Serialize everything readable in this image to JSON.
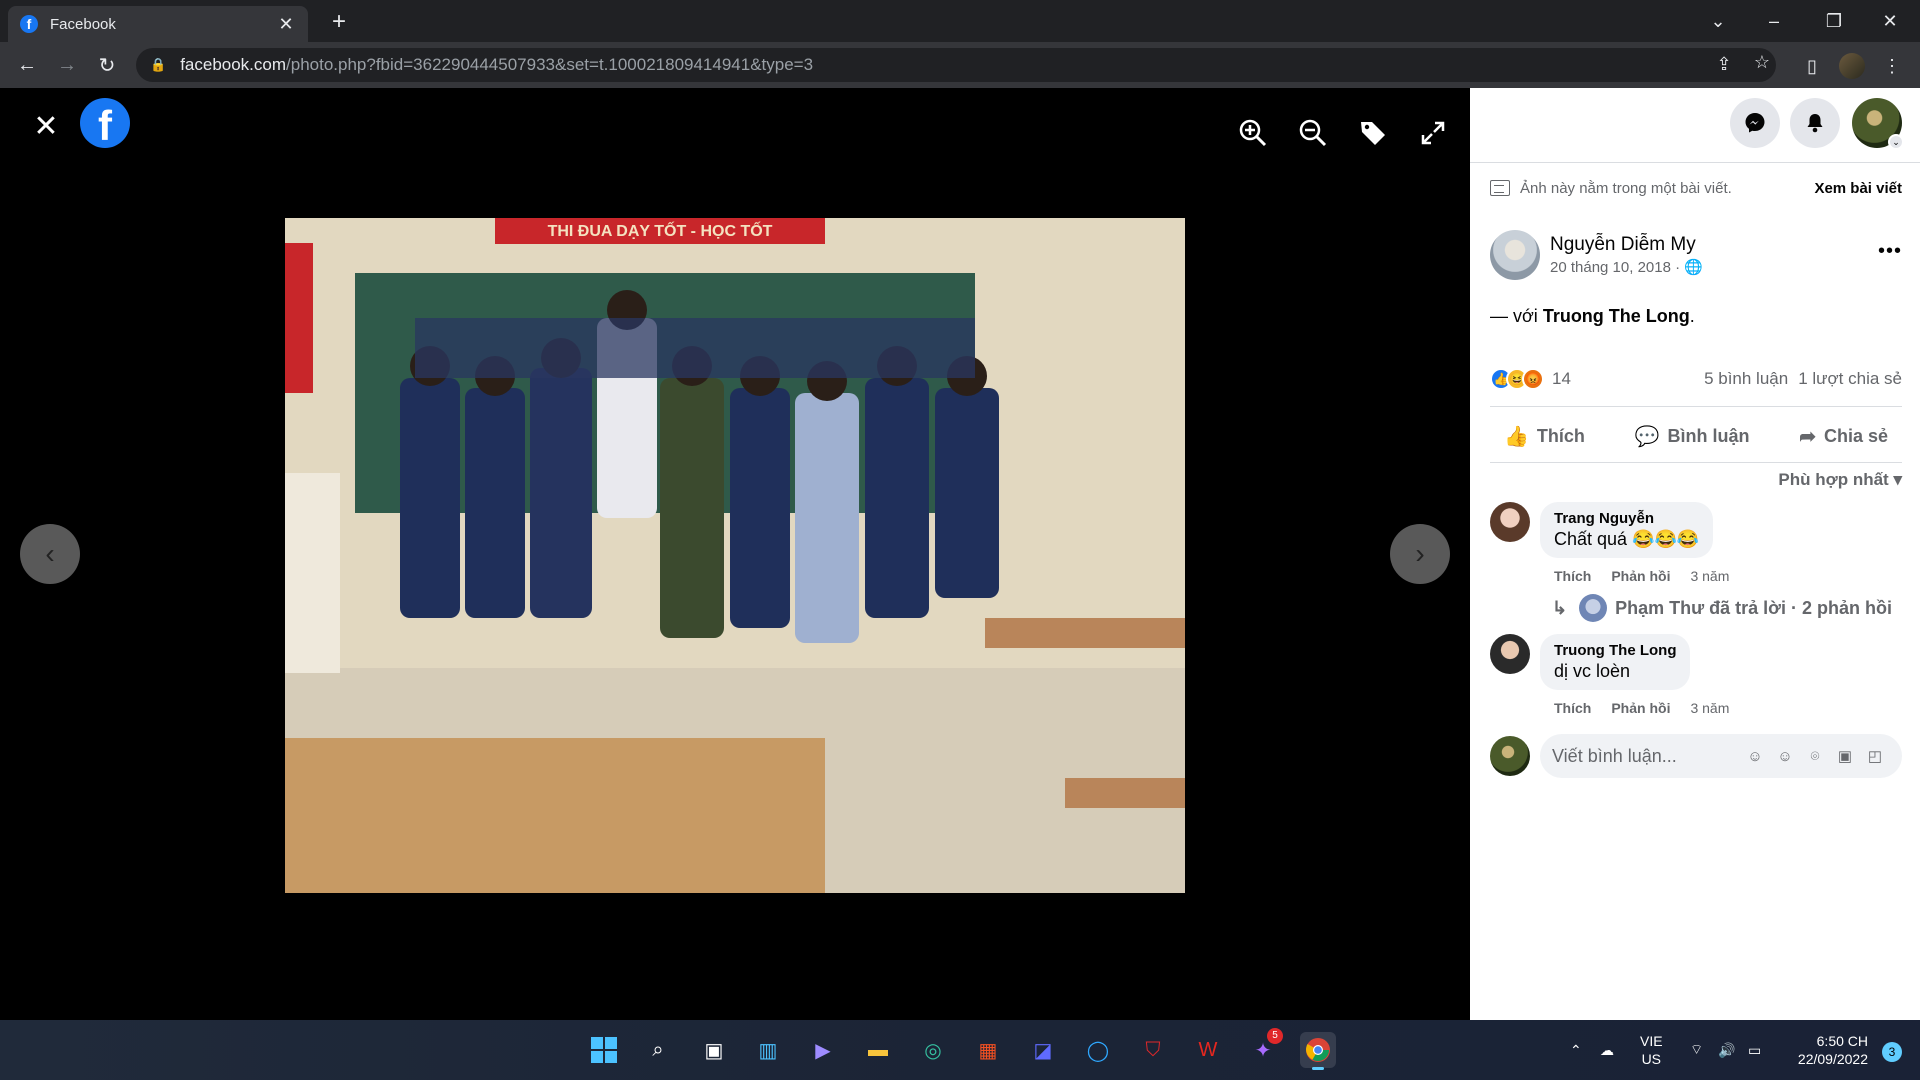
{
  "browser": {
    "tab_title": "Facebook",
    "tab_favicon": "f",
    "url_host": "facebook.com",
    "url_path": "/photo.php?fbid=362290444507933&set=t.100021809414941&type=3",
    "accent": "#1877f2"
  },
  "viewer": {
    "logo_letter": "f",
    "tools": [
      "zoom-in-icon",
      "zoom-out-icon",
      "tag-icon",
      "fullscreen-icon"
    ]
  },
  "panel": {
    "notice_text": "Ảnh này nằm trong một bài viết.",
    "notice_link": "Xem bài viết",
    "post": {
      "author": "Nguyễn Diễm My",
      "date": "20 tháng 10, 2018 ·",
      "with_prefix": "— với ",
      "with_name": "Truong The Long",
      "with_suffix": "."
    },
    "stats": {
      "reactions_count": "14",
      "comments": "5 bình luận",
      "shares": "1 lượt chia sẻ"
    },
    "actions": {
      "like": "Thích",
      "comment": "Bình luận",
      "share": "Chia sẻ"
    },
    "sort_label": "Phù hợp nhất",
    "comments": [
      {
        "name": "Trang Nguyễn",
        "text": "Chất quá 😂😂😂",
        "like": "Thích",
        "reply": "Phản hồi",
        "time": "3 năm"
      },
      {
        "name": "Truong The Long",
        "text": "dị vc loèn",
        "like": "Thích",
        "reply": "Phản hồi",
        "time": "3 năm"
      }
    ],
    "replies_text": "Phạm Thư đã trả lời · 2 phản hồi",
    "compose_placeholder": "Viết bình luận..."
  },
  "taskbar": {
    "lang_line1": "VIE",
    "lang_line2": "US",
    "time": "6:50 CH",
    "date": "22/09/2022",
    "notif_count": "3",
    "messenger_badge": "5"
  }
}
